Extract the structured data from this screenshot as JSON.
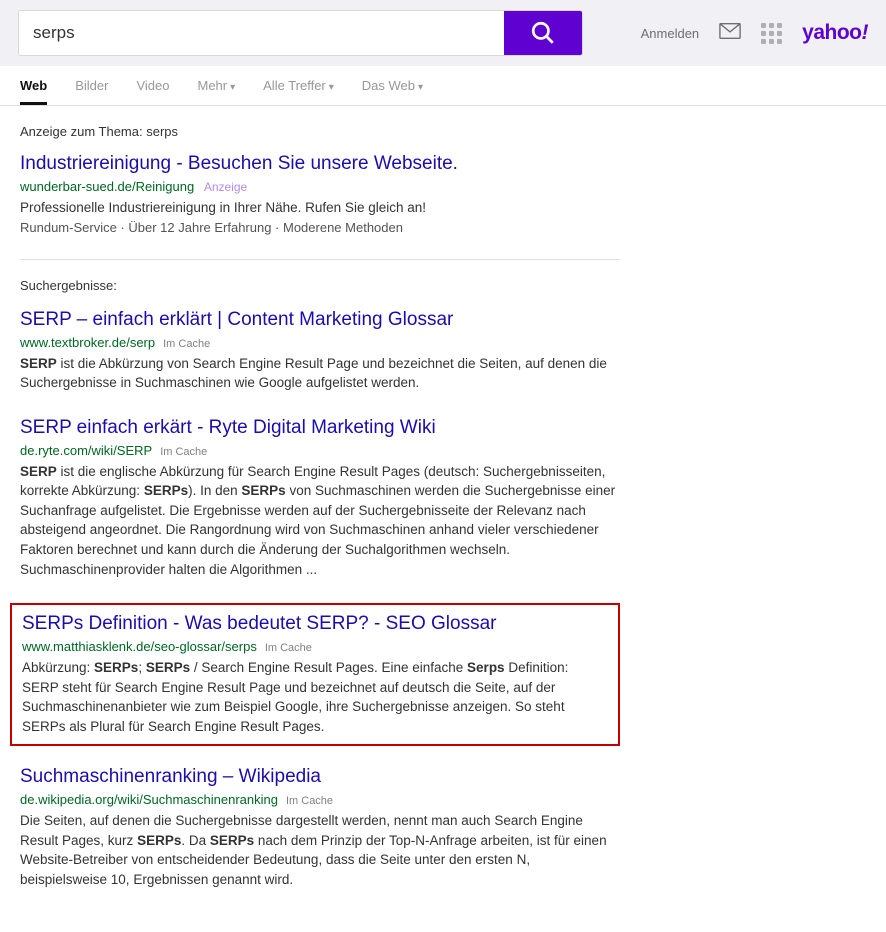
{
  "header": {
    "search_query": "serps",
    "signin": "Anmelden",
    "logo": "yahoo!"
  },
  "tabs": {
    "web": "Web",
    "images": "Bilder",
    "video": "Video",
    "more": "Mehr",
    "all_hits": "Alle Treffer",
    "the_web": "Das Web"
  },
  "ad": {
    "header": "Anzeige zum Thema: serps",
    "title": "Industriereinigung - Besuchen Sie unsere Webseite.",
    "url": "wunderbar-sued.de/Reinigung",
    "label": "Anzeige",
    "desc": "Professionelle Industriereinigung in Ihrer Nähe. Rufen Sie gleich an!",
    "sub": "Rundum-Service · Über 12 Jahre Erfahrung · Moderene Methoden"
  },
  "results_label": "Suchergebnisse:",
  "cache_label": "Im Cache",
  "results": [
    {
      "title": "SERP – einfach erklärt | Content Marketing Glossar",
      "url": "www.textbroker.de/serp",
      "desc_html": "<b>SERP</b> ist die Abkürzung von Search Engine Result Page und bezeichnet die Seiten, auf denen die Suchergebnisse in Suchmaschinen wie Google aufgelistet werden."
    },
    {
      "title": "SERP einfach erkärt - Ryte Digital Marketing Wiki",
      "url": "de.ryte.com/wiki/SERP",
      "desc_html": "<b>SERP</b> ist die englische Abkürzung für Search Engine Result Pages (deutsch: Suchergebnisseiten, korrekte Abkürzung: <b>SERPs</b>). In den <b>SERPs</b> von Suchmaschinen werden die Suchergebnisse einer Suchanfrage aufgelistet. Die Ergebnisse werden auf der Suchergebnisseite der Relevanz nach absteigend angeordnet. Die Rangordnung wird von Suchmaschinen anhand vieler verschiedener Faktoren berechnet und kann durch die Änderung der Suchalgorithmen wechseln. Suchmaschinenprovider halten die Algorithmen ..."
    },
    {
      "title": "SERPs Definition - Was bedeutet SERP? - SEO Glossar",
      "url": "www.matthiasklenk.de/seo-glossar/serps",
      "desc_html": "Abkürzung: <b>SERPs</b>; <b>SERPs</b> / Search Engine Result Pages. Eine einfache <b>Serps</b> Definition: SERP steht für Search Engine Result Page und bezeichnet auf deutsch die Seite, auf der Suchmaschinenanbieter wie zum Beispiel Google, ihre Suchergebnisse anzeigen. So steht SERPs als Plural für Search Engine Result Pages.",
      "highlighted": true
    },
    {
      "title": "Suchmaschinenranking – Wikipedia",
      "url": "de.wikipedia.org/wiki/Suchmaschinenranking",
      "desc_html": "Die Seiten, auf denen die Suchergebnisse dargestellt werden, nennt man auch Search Engine Result Pages, kurz <b>SERPs</b>. Da <b>SERPs</b> nach dem Prinzip der Top-N-Anfrage arbeiten, ist für einen Website-Betreiber von entscheidender Bedeutung, dass die Seite unter den ersten N, beispielsweise 10, Ergebnissen genannt wird."
    }
  ]
}
